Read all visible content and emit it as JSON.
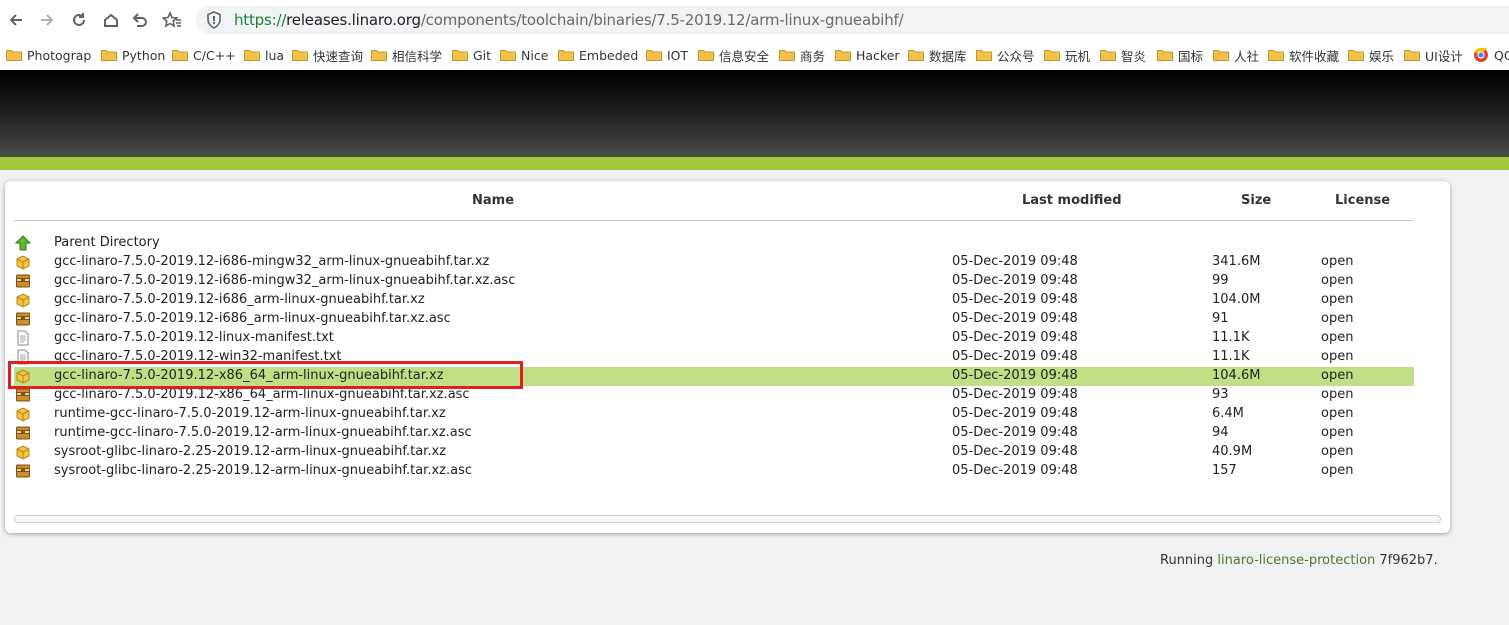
{
  "browser": {
    "url_scheme": "https://",
    "url_host": "releases.linaro.org",
    "url_path": "/components/toolchain/binaries/7.5-2019.12/arm-linux-gnueabihf/"
  },
  "bookmarks": [
    "Photograp",
    "Python",
    "C/C++",
    "lua",
    "快速查询",
    "相信科学",
    "Git",
    "Nice",
    "Embeded",
    "IOT",
    "信息安全",
    "商务",
    "Hacker",
    "数据库",
    "公众号",
    "玩机",
    "智炎",
    "国标",
    "人社",
    "软件收藏",
    "娱乐",
    "UI设计",
    "QQ"
  ],
  "table": {
    "headers": {
      "name": "Name",
      "modified": "Last modified",
      "size": "Size",
      "license": "License"
    },
    "parent": "Parent Directory",
    "rows": [
      {
        "name": "gcc-linaro-7.5.0-2019.12-i686-mingw32_arm-linux-gnueabihf.tar.xz",
        "modified": "05-Dec-2019 09:48",
        "size": "341.6M",
        "license": "open",
        "icon": "package-icon"
      },
      {
        "name": "gcc-linaro-7.5.0-2019.12-i686-mingw32_arm-linux-gnueabihf.tar.xz.asc",
        "modified": "05-Dec-2019 09:48",
        "size": "99",
        "license": "open",
        "icon": "archive-icon"
      },
      {
        "name": "gcc-linaro-7.5.0-2019.12-i686_arm-linux-gnueabihf.tar.xz",
        "modified": "05-Dec-2019 09:48",
        "size": "104.0M",
        "license": "open",
        "icon": "package-icon"
      },
      {
        "name": "gcc-linaro-7.5.0-2019.12-i686_arm-linux-gnueabihf.tar.xz.asc",
        "modified": "05-Dec-2019 09:48",
        "size": "91",
        "license": "open",
        "icon": "archive-icon"
      },
      {
        "name": "gcc-linaro-7.5.0-2019.12-linux-manifest.txt",
        "modified": "05-Dec-2019 09:48",
        "size": "11.1K",
        "license": "open",
        "icon": "text-file-icon"
      },
      {
        "name": "gcc-linaro-7.5.0-2019.12-win32-manifest.txt",
        "modified": "05-Dec-2019 09:48",
        "size": "11.1K",
        "license": "open",
        "icon": "text-file-icon"
      },
      {
        "name": "gcc-linaro-7.5.0-2019.12-x86_64_arm-linux-gnueabihf.tar.xz",
        "modified": "05-Dec-2019 09:48",
        "size": "104.6M",
        "license": "open",
        "icon": "package-icon"
      },
      {
        "name": "gcc-linaro-7.5.0-2019.12-x86_64_arm-linux-gnueabihf.tar.xz.asc",
        "modified": "05-Dec-2019 09:48",
        "size": "93",
        "license": "open",
        "icon": "archive-icon"
      },
      {
        "name": "runtime-gcc-linaro-7.5.0-2019.12-arm-linux-gnueabihf.tar.xz",
        "modified": "05-Dec-2019 09:48",
        "size": "6.4M",
        "license": "open",
        "icon": "package-icon"
      },
      {
        "name": "runtime-gcc-linaro-7.5.0-2019.12-arm-linux-gnueabihf.tar.xz.asc",
        "modified": "05-Dec-2019 09:48",
        "size": "94",
        "license": "open",
        "icon": "archive-icon"
      },
      {
        "name": "sysroot-glibc-linaro-2.25-2019.12-arm-linux-gnueabihf.tar.xz",
        "modified": "05-Dec-2019 09:48",
        "size": "40.9M",
        "license": "open",
        "icon": "package-icon"
      },
      {
        "name": "sysroot-glibc-linaro-2.25-2019.12-arm-linux-gnueabihf.tar.xz.asc",
        "modified": "05-Dec-2019 09:48",
        "size": "157",
        "license": "open",
        "icon": "archive-icon"
      }
    ],
    "highlighted_row": 6
  },
  "footer": {
    "prefix": "Running ",
    "link": "linaro-license-protection",
    "version": " 7f962b7."
  },
  "colors": {
    "accent_green": "#a2c73b",
    "row_highlight": "#c3df86",
    "annotation_red": "#e02020"
  }
}
